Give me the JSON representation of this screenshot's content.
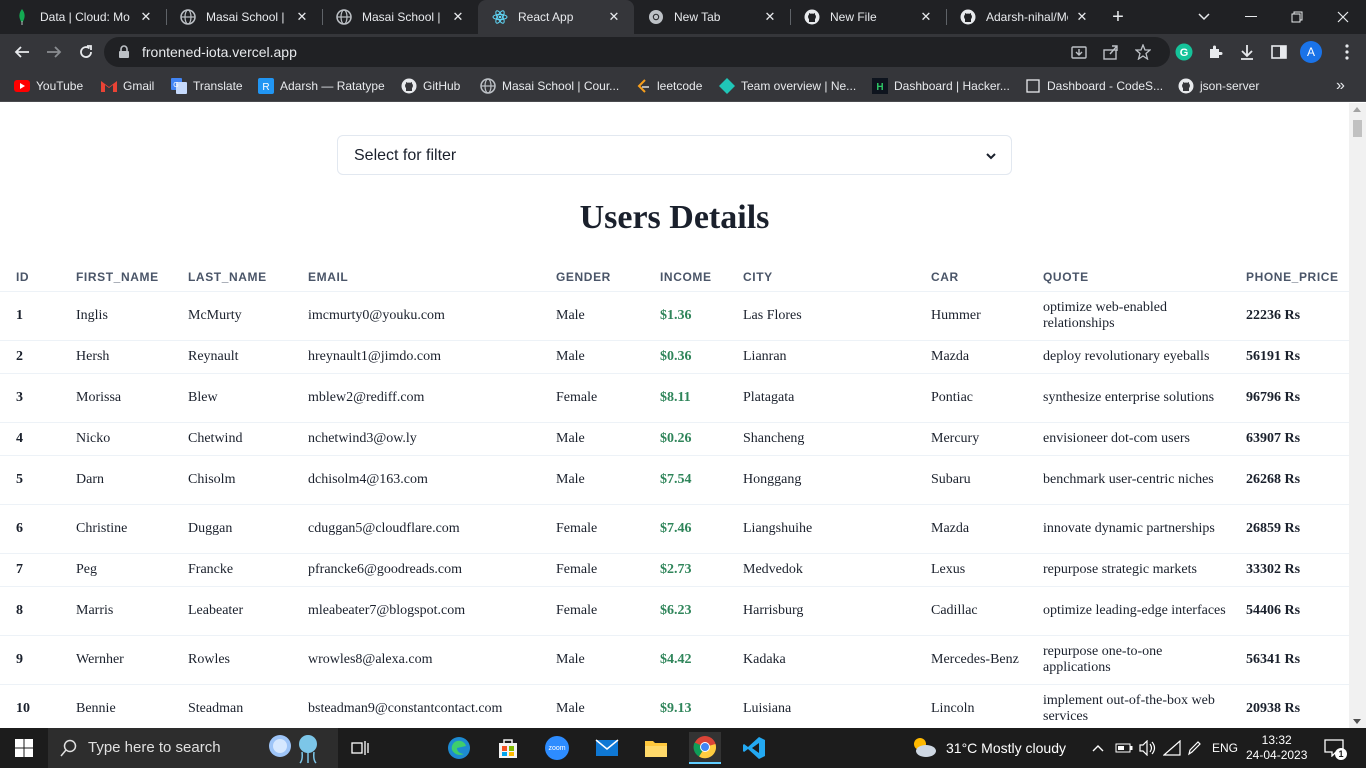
{
  "tabs": [
    {
      "title": "Data | Cloud: Mo",
      "icon": "mongodb-leaf-icon",
      "active": false
    },
    {
      "title": "Masai School | Pla",
      "icon": "masai-globe-icon",
      "active": false
    },
    {
      "title": "Masai School | Co",
      "icon": "masai-globe-icon",
      "active": false
    },
    {
      "title": "React App",
      "icon": "react-icon",
      "active": true
    },
    {
      "title": "New Tab",
      "icon": "chrome-icon",
      "active": false
    },
    {
      "title": "New File",
      "icon": "github-icon",
      "active": false
    },
    {
      "title": "Adarsh-nihal/Mo",
      "icon": "github-icon",
      "active": false
    }
  ],
  "toolbar": {
    "url": "frontened-iota.vercel.app",
    "profile_initial": "A"
  },
  "bookmarks": [
    {
      "label": "YouTube",
      "icon": "youtube-icon"
    },
    {
      "label": "Gmail",
      "icon": "gmail-icon"
    },
    {
      "label": "Translate",
      "icon": "translate-icon"
    },
    {
      "label": "Adarsh — Ratatype",
      "icon": "ratatype-icon"
    },
    {
      "label": "GitHub",
      "icon": "github-icon"
    },
    {
      "label": "Masai School | Cour...",
      "icon": "masai-globe-icon"
    },
    {
      "label": "leetcode",
      "icon": "leetcode-icon"
    },
    {
      "label": "Team overview | Ne...",
      "icon": "netlify-icon"
    },
    {
      "label": "Dashboard | Hacker...",
      "icon": "hackerrank-icon"
    },
    {
      "label": "Dashboard - CodeS...",
      "icon": "codesignal-icon"
    },
    {
      "label": "json-server",
      "icon": "github-icon"
    }
  ],
  "filter": {
    "placeholder": "Select for filter"
  },
  "title": "Users Details",
  "table": {
    "columns": [
      "ID",
      "FIRST_NAME",
      "LAST_NAME",
      "EMAIL",
      "GENDER",
      "INCOME",
      "CITY",
      "CAR",
      "QUOTE",
      "PHONE_PRICE"
    ],
    "rows": [
      {
        "id": "1",
        "first": "Inglis",
        "last": "McMurty",
        "email": "imcmurty0@youku.com",
        "gender": "Male",
        "income": "$1.36",
        "city": "Las Flores",
        "car": "Hummer",
        "quote": "optimize web-enabled relationships",
        "price": "22236 Rs"
      },
      {
        "id": "2",
        "first": "Hersh",
        "last": "Reynault",
        "email": "hreynault1@jimdo.com",
        "gender": "Male",
        "income": "$0.36",
        "city": "Lianran",
        "car": "Mazda",
        "quote": "deploy revolutionary eyeballs",
        "price": "56191 Rs"
      },
      {
        "id": "3",
        "first": "Morissa",
        "last": "Blew",
        "email": "mblew2@rediff.com",
        "gender": "Female",
        "income": "$8.11",
        "city": "Platagata",
        "car": "Pontiac",
        "quote": "synthesize enterprise solutions",
        "price": "96796 Rs"
      },
      {
        "id": "4",
        "first": "Nicko",
        "last": "Chetwind",
        "email": "nchetwind3@ow.ly",
        "gender": "Male",
        "income": "$0.26",
        "city": "Shancheng",
        "car": "Mercury",
        "quote": "envisioneer dot-com users",
        "price": "63907 Rs"
      },
      {
        "id": "5",
        "first": "Darn",
        "last": "Chisolm",
        "email": "dchisolm4@163.com",
        "gender": "Male",
        "income": "$7.54",
        "city": "Honggang",
        "car": "Subaru",
        "quote": "benchmark user-centric niches",
        "price": "26268 Rs"
      },
      {
        "id": "6",
        "first": "Christine",
        "last": "Duggan",
        "email": "cduggan5@cloudflare.com",
        "gender": "Female",
        "income": "$7.46",
        "city": "Liangshuihe",
        "car": "Mazda",
        "quote": "innovate dynamic partnerships",
        "price": "26859 Rs"
      },
      {
        "id": "7",
        "first": "Peg",
        "last": "Francke",
        "email": "pfrancke6@goodreads.com",
        "gender": "Female",
        "income": "$2.73",
        "city": "Medvedok",
        "car": "Lexus",
        "quote": "repurpose strategic markets",
        "price": "33302 Rs"
      },
      {
        "id": "8",
        "first": "Marris",
        "last": "Leabeater",
        "email": "mleabeater7@blogspot.com",
        "gender": "Female",
        "income": "$6.23",
        "city": "Harrisburg",
        "car": "Cadillac",
        "quote": "optimize leading-edge interfaces",
        "price": "54406 Rs"
      },
      {
        "id": "9",
        "first": "Wernher",
        "last": "Rowles",
        "email": "wrowles8@alexa.com",
        "gender": "Male",
        "income": "$4.42",
        "city": "Kadaka",
        "car": "Mercedes-Benz",
        "quote": "repurpose one-to-one applications",
        "price": "56341 Rs"
      },
      {
        "id": "10",
        "first": "Bennie",
        "last": "Steadman",
        "email": "bsteadman9@constantcontact.com",
        "gender": "Male",
        "income": "$9.13",
        "city": "Luisiana",
        "car": "Lincoln",
        "quote": "implement out-of-the-box web services",
        "price": "20938 Rs"
      }
    ]
  },
  "taskbar": {
    "search_placeholder": "Type here to search",
    "zoom_label": "zoom",
    "weather": "31°C  Mostly cloudy",
    "language": "ENG",
    "time": "13:32",
    "date": "24-04-2023",
    "notification_count": "1"
  }
}
